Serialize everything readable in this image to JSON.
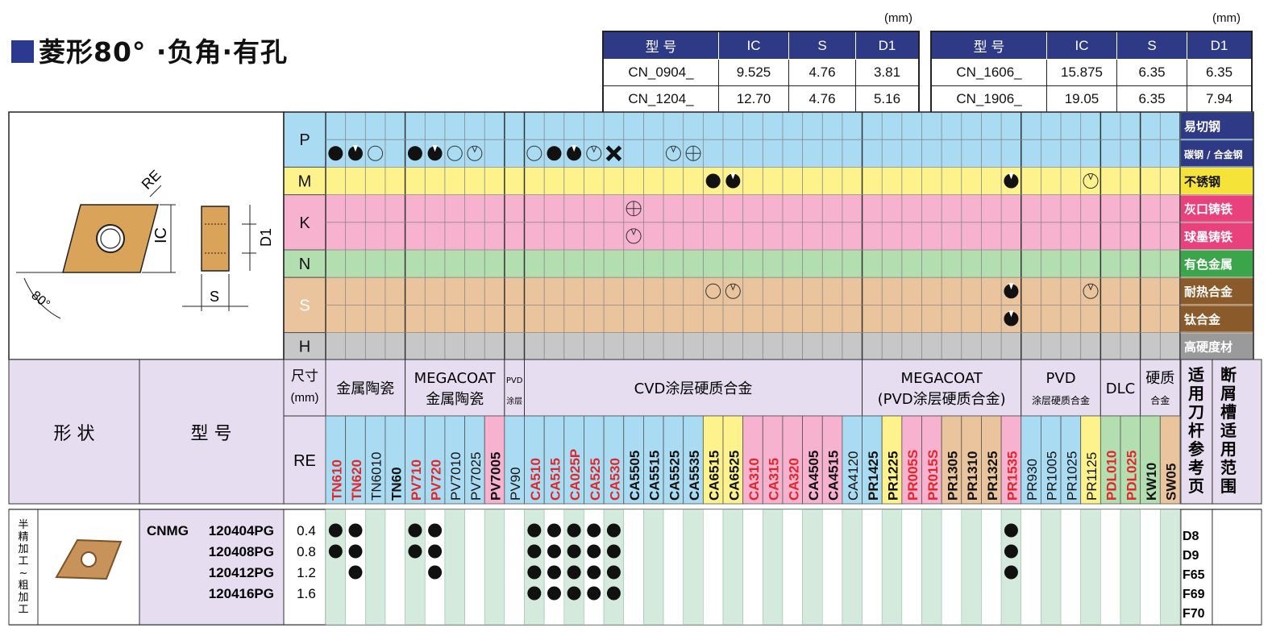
{
  "title": "菱形80° ·负角·有孔",
  "dim_unit": "(mm)",
  "dim_table_left": {
    "headers": [
      "型 号",
      "IC",
      "S",
      "D1"
    ],
    "rows": [
      [
        "CN_0904_",
        "9.525",
        "4.76",
        "3.81"
      ],
      [
        "CN_1204_",
        "12.70",
        "4.76",
        "5.16"
      ]
    ]
  },
  "dim_table_right": {
    "headers": [
      "型 号",
      "IC",
      "S",
      "D1"
    ],
    "rows": [
      [
        "CN_1606_",
        "15.875",
        "6.35",
        "6.35"
      ],
      [
        "CN_1906_",
        "19.05",
        "6.35",
        "7.94"
      ]
    ]
  },
  "diagram_labels": {
    "re": "RE",
    "ic": "IC",
    "d1": "D1",
    "s": "S",
    "angle": "80°"
  },
  "materials": [
    {
      "code": "P",
      "color": "#a9dcf3",
      "labels": [
        {
          "text": "易切钢",
          "bg": "#2e3a86"
        },
        {
          "text": "碳钢 / 合金钢",
          "bg": "#2e3a86"
        }
      ]
    },
    {
      "code": "M",
      "color": "#fdf28c",
      "labels": [
        {
          "text": "不锈钢",
          "bg": "#f6e33a"
        }
      ]
    },
    {
      "code": "K",
      "color": "#f7b2cf",
      "labels": [
        {
          "text": "灰口铸铁",
          "bg": "#e8417c"
        },
        {
          "text": "球墨铸铁",
          "bg": "#e8417c"
        }
      ]
    },
    {
      "code": "N",
      "color": "#b3deb0",
      "labels": [
        {
          "text": "有色金属",
          "bg": "#3aa54a"
        }
      ]
    },
    {
      "code": "S",
      "color": "#eac49c",
      "labels": [
        {
          "text": "耐热合金",
          "bg": "#8a5a2b"
        },
        {
          "text": "钛合金",
          "bg": "#8a5a2b"
        }
      ]
    },
    {
      "code": "H",
      "color": "#c7c7c7",
      "labels": [
        {
          "text": "高硬度材",
          "bg": "#9a9a9a"
        }
      ]
    }
  ],
  "grades": [
    "TN610",
    "TN620",
    "TN6010",
    "TN60",
    "PV710",
    "PV720",
    "PV7010",
    "PV7025",
    "PV7005",
    "PV90",
    "CA510",
    "CA515",
    "CA025P",
    "CA525",
    "CA530",
    "CA5505",
    "CA5515",
    "CA5525",
    "CA5535",
    "CA6515",
    "CA6525",
    "CA310",
    "CA315",
    "CA320",
    "CA4505",
    "CA4515",
    "CA4120",
    "PR1425",
    "PR1225",
    "PR005S",
    "PR015S",
    "PR1305",
    "PR1310",
    "PR1325",
    "PR1535",
    "PR930",
    "PR1005",
    "PR1025",
    "PR1125",
    "PDL010",
    "PDL025",
    "KW10",
    "SW05"
  ],
  "groups": [
    {
      "label": "金属陶瓷"
    },
    {
      "label": "MEGACOAT 金属陶瓷"
    },
    {
      "label": "PVD 涂层"
    },
    {
      "label": "CVD涂层硬质合金"
    },
    {
      "label": "MEGACOAT (PVD涂层硬质合金)"
    },
    {
      "label": "PVD 涂层硬质合金"
    },
    {
      "label": "DLC"
    },
    {
      "label": "硬质 合金"
    }
  ],
  "header_labels": {
    "shape": "形 状",
    "model": "型 号",
    "size": "尺寸 (mm)",
    "re": "RE",
    "holder": "适用刀杆参考页",
    "chipbreaker": "断屑槽适用范围"
  },
  "recommendation_marks": [
    {
      "row": 1,
      "col": 0,
      "mark": "●"
    },
    {
      "row": 1,
      "col": 1,
      "mark": "◕"
    },
    {
      "row": 1,
      "col": 2,
      "mark": "○"
    },
    {
      "row": 1,
      "col": 4,
      "mark": "●"
    },
    {
      "row": 1,
      "col": 5,
      "mark": "◕"
    },
    {
      "row": 1,
      "col": 6,
      "mark": "○"
    },
    {
      "row": 1,
      "col": 7,
      "mark": "◌"
    },
    {
      "row": 1,
      "col": 10,
      "mark": "○"
    },
    {
      "row": 1,
      "col": 11,
      "mark": "●"
    },
    {
      "row": 1,
      "col": 12,
      "mark": "◕"
    },
    {
      "row": 1,
      "col": 13,
      "mark": "◌"
    },
    {
      "row": 1,
      "col": 14,
      "mark": "✖"
    },
    {
      "row": 1,
      "col": 17,
      "mark": "◌"
    },
    {
      "row": 1,
      "col": 18,
      "mark": "⊕"
    },
    {
      "row": 2,
      "col": 19,
      "mark": "●"
    },
    {
      "row": 2,
      "col": 20,
      "mark": "◕"
    },
    {
      "row": 2,
      "col": 34,
      "mark": "◕"
    },
    {
      "row": 2,
      "col": 38,
      "mark": "◌"
    },
    {
      "row": 3,
      "col": 15,
      "mark": "⊕"
    },
    {
      "row": 4,
      "col": 15,
      "mark": "◌"
    },
    {
      "row": 6,
      "col": 19,
      "mark": "○"
    },
    {
      "row": 6,
      "col": 20,
      "mark": "◌"
    },
    {
      "row": 6,
      "col": 34,
      "mark": "◕"
    },
    {
      "row": 6,
      "col": 38,
      "mark": "◌"
    },
    {
      "row": 7,
      "col": 34,
      "mark": "◕"
    }
  ],
  "product": {
    "application": "半精加工~粗加工",
    "series": "CNMG",
    "rows": [
      {
        "model": "120404PG",
        "re": "0.4",
        "cols": [
          0,
          1,
          4,
          5,
          10,
          11,
          12,
          13,
          14,
          34
        ]
      },
      {
        "model": "120408PG",
        "re": "0.8",
        "cols": [
          0,
          1,
          4,
          5,
          10,
          11,
          12,
          13,
          14,
          34
        ]
      },
      {
        "model": "120412PG",
        "re": "1.2",
        "cols": [
          1,
          5,
          10,
          11,
          12,
          13,
          14,
          34
        ]
      },
      {
        "model": "120416PG",
        "re": "1.6",
        "cols": [
          10,
          11,
          12,
          13,
          14
        ]
      }
    ],
    "holder_pages": [
      "D8",
      "D9",
      "F65",
      "F69",
      "F70"
    ]
  }
}
